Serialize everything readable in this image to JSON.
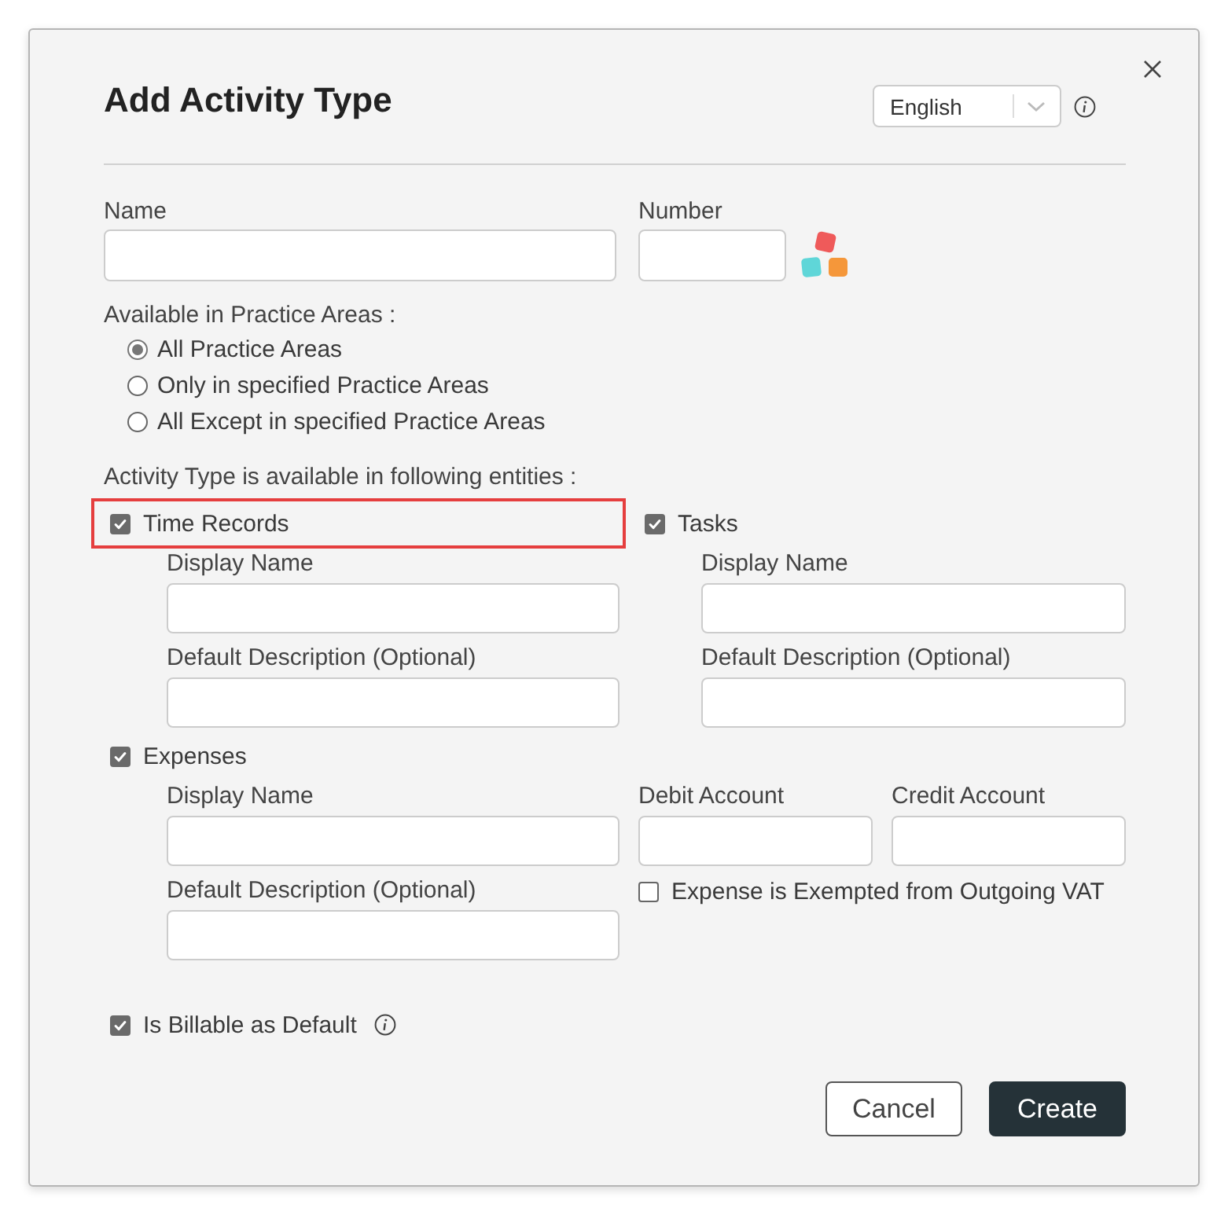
{
  "dialog": {
    "title": "Add Activity Type",
    "language_select": {
      "value": "English"
    }
  },
  "name_field": {
    "label": "Name"
  },
  "number_field": {
    "label": "Number"
  },
  "practice_areas": {
    "label": "Available in Practice Areas :",
    "options": [
      {
        "label": "All Practice Areas",
        "selected": true
      },
      {
        "label": "Only in specified Practice Areas",
        "selected": false
      },
      {
        "label": "All Except in specified Practice Areas",
        "selected": false
      }
    ]
  },
  "entities": {
    "label": "Activity Type is available in following entities :",
    "items": [
      {
        "label": "Time Records",
        "checked": true,
        "highlighted": true,
        "fields": [
          {
            "label": "Display Name"
          },
          {
            "label": "Default Description (Optional)"
          }
        ]
      },
      {
        "label": "Tasks",
        "checked": true,
        "highlighted": false,
        "fields": [
          {
            "label": "Display Name"
          },
          {
            "label": "Default Description (Optional)"
          }
        ]
      },
      {
        "label": "Expenses",
        "checked": true,
        "highlighted": false,
        "fields": [
          {
            "label": "Display Name"
          },
          {
            "label": "Default Description (Optional)"
          }
        ],
        "accounts": [
          {
            "label": "Debit Account"
          },
          {
            "label": "Credit Account"
          }
        ],
        "vat_exempt": {
          "label": "Expense is Exempted from Outgoing VAT",
          "checked": false
        }
      }
    ]
  },
  "billable": {
    "label": "Is Billable as Default",
    "checked": true
  },
  "buttons": [
    {
      "label": "Cancel",
      "kind": "secondary"
    },
    {
      "label": "Create",
      "kind": "primary"
    }
  ]
}
